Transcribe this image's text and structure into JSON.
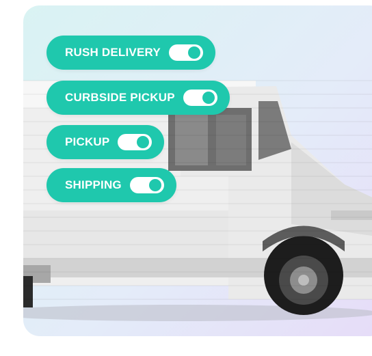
{
  "colors": {
    "accent": "#1fc8ad",
    "toggle_track": "#ffffff",
    "background_start": "#d9f3f3",
    "background_end": "#e6dcf8"
  },
  "image": {
    "subject_icon": "delivery-van-image"
  },
  "options": [
    {
      "label": "RUSH DELIVERY",
      "enabled": true
    },
    {
      "label": "CURBSIDE PICKUP",
      "enabled": true
    },
    {
      "label": "PICKUP",
      "enabled": true
    },
    {
      "label": "SHIPPING",
      "enabled": true
    }
  ]
}
